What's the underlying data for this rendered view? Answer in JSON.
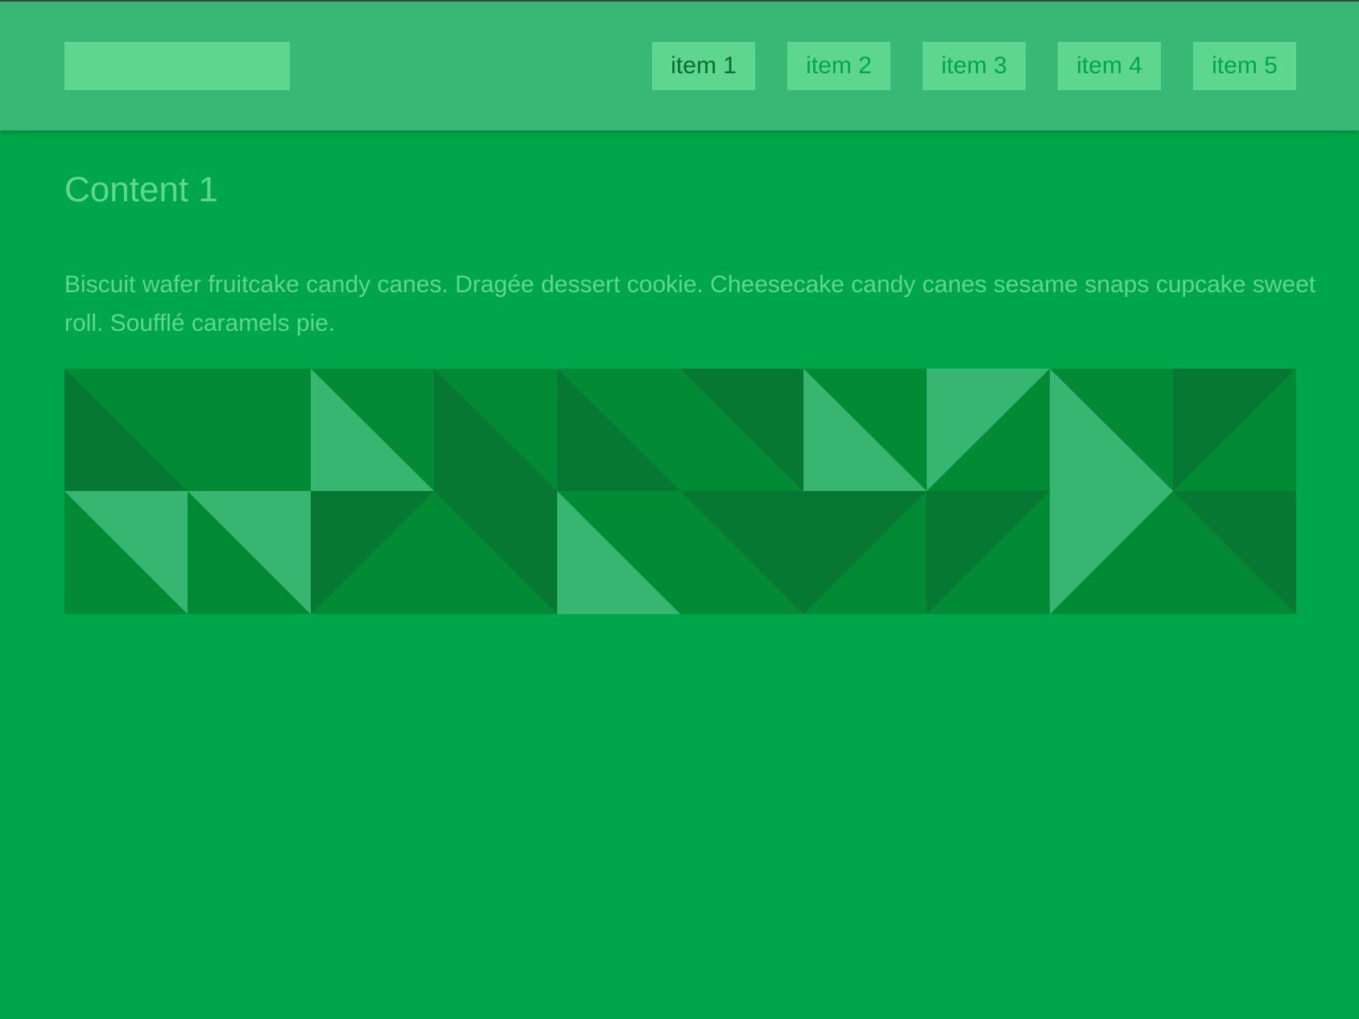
{
  "header": {
    "nav": [
      {
        "label": "item 1",
        "active": true
      },
      {
        "label": "item 2",
        "active": false
      },
      {
        "label": "item 3",
        "active": false
      },
      {
        "label": "item 4",
        "active": false
      },
      {
        "label": "item 5",
        "active": false
      }
    ]
  },
  "content": {
    "title": "Content 1",
    "body": "Biscuit wafer fruitcake candy canes. Dragée dessert cookie. Cheesecake candy canes sesame snaps cupcake sweet roll. Soufflé caramels pie."
  },
  "colors": {
    "background": "#00a74a",
    "header": "#39b775",
    "nav_button": "#5fd68f",
    "tile_mid": "#028a34",
    "tile_dark": "#067833",
    "tile_light": "#38b570"
  }
}
